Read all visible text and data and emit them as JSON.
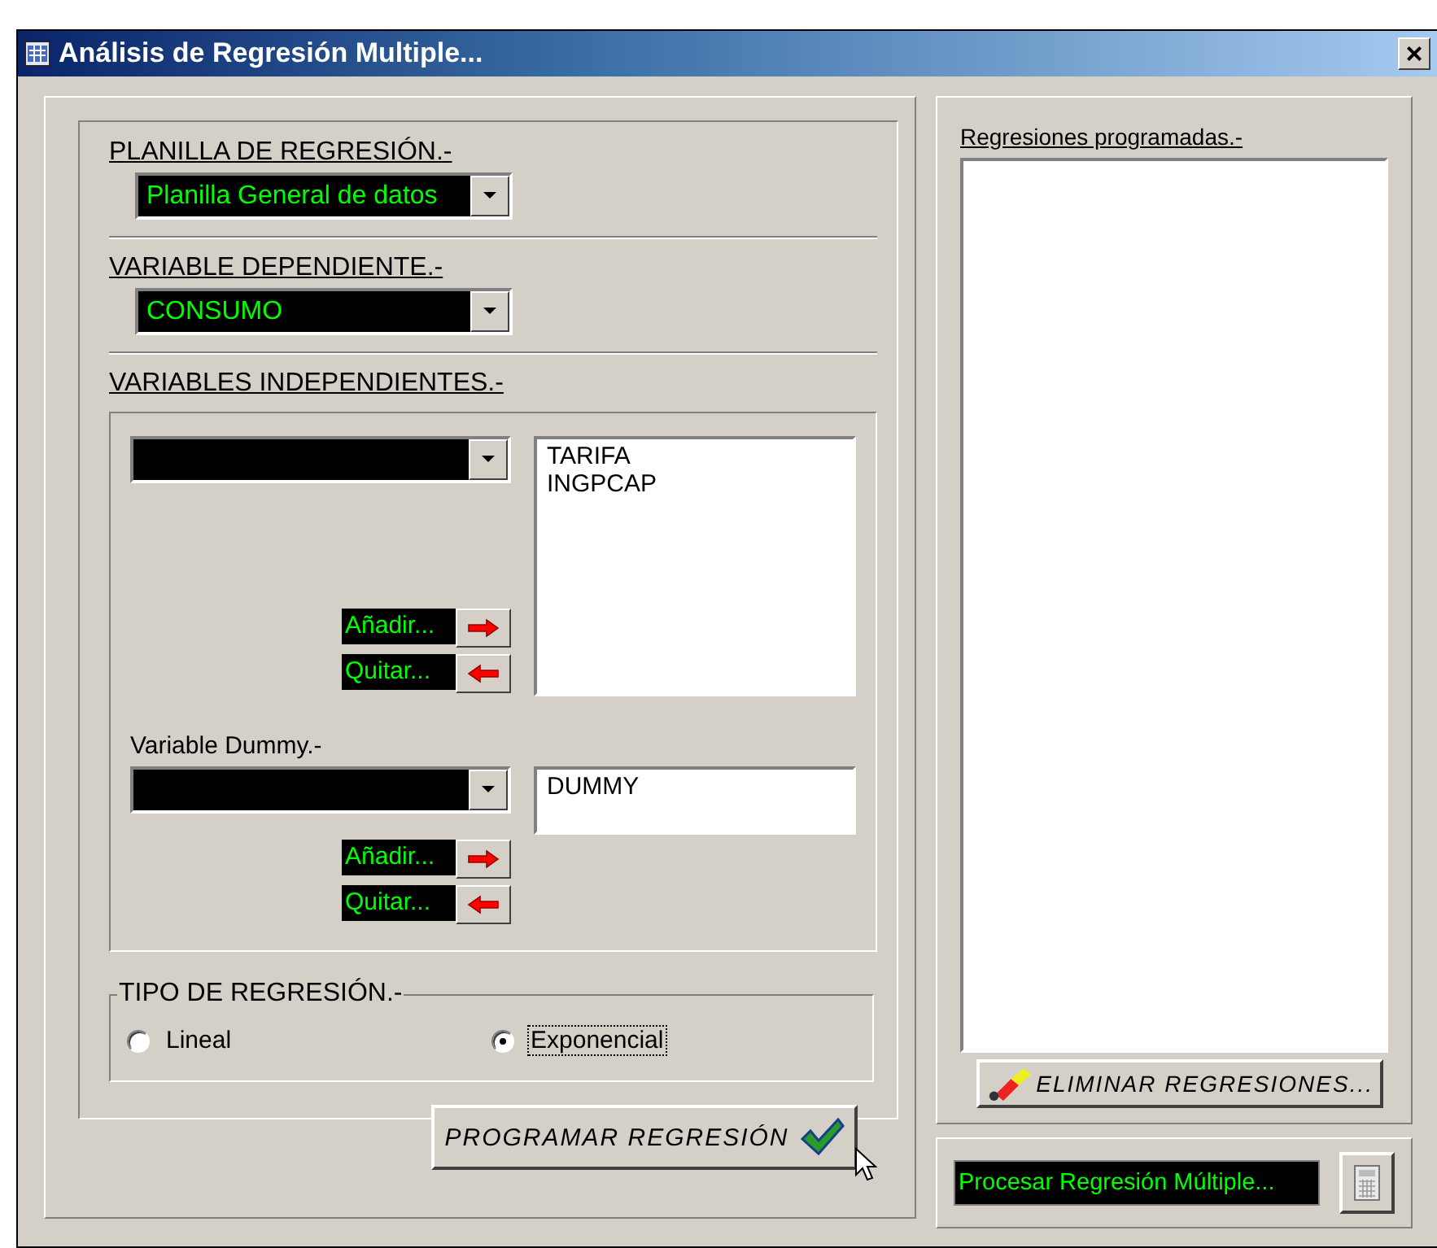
{
  "window": {
    "title": "Análisis de Regresión Multiple...",
    "close": "×"
  },
  "planilla": {
    "label": "PLANILLA DE REGRESIÓN.-",
    "value": "Planilla General de datos"
  },
  "dependiente": {
    "label": "VARIABLE DEPENDIENTE.-",
    "value": "CONSUMO"
  },
  "independientes": {
    "label": "VARIABLES INDEPENDIENTES.-",
    "items": [
      "TARIFA",
      "INGPCAP"
    ],
    "add": "Añadir...",
    "remove": "Quitar..."
  },
  "dummy": {
    "label": "Variable Dummy.-",
    "items": [
      "DUMMY"
    ],
    "add": "Añadir...",
    "remove": "Quitar..."
  },
  "tipo": {
    "label": "TIPO DE REGRESIÓN.-",
    "options": [
      {
        "label": "Lineal",
        "selected": false
      },
      {
        "label": "Exponencial",
        "selected": true
      }
    ]
  },
  "program_button": {
    "label": "PROGRAMAR REGRESIÓN"
  },
  "programadas": {
    "label": "Regresiones programadas.-"
  },
  "delete_button": {
    "label": "ELIMINAR REGRESIONES..."
  },
  "process": {
    "label": "Procesar Regresión Múltiple..."
  }
}
